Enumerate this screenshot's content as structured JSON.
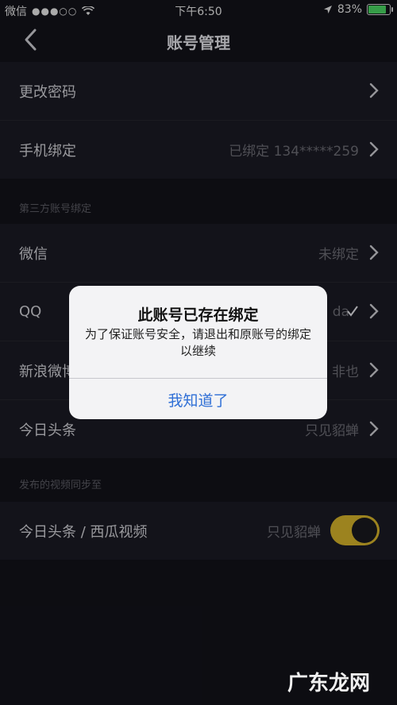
{
  "status": {
    "carrier": "微信",
    "signal_dots": "●●●○○",
    "time": "下午6:50",
    "battery_pct": "83%"
  },
  "nav": {
    "title": "账号管理"
  },
  "account": {
    "items": [
      {
        "label": "更改密码",
        "value": ""
      },
      {
        "label": "手机绑定",
        "value": "已绑定 134*****259"
      }
    ]
  },
  "third_party": {
    "header": "第三方账号绑定",
    "items": [
      {
        "label": "微信",
        "value": "未绑定"
      },
      {
        "label": "QQ",
        "value": "da"
      },
      {
        "label": "新浪微博",
        "value": "非也"
      },
      {
        "label": "今日头条",
        "value": "只见貂蝉"
      }
    ]
  },
  "sync": {
    "header": "发布的视频同步至",
    "item": {
      "label": "今日头条 / 西瓜视频",
      "value": "只见貂蝉",
      "enabled": true
    }
  },
  "alert": {
    "title": "此账号已存在绑定",
    "message": "为了保证账号安全，请退出和原账号的绑定以继续",
    "button": "我知道了"
  },
  "watermark": "广东龙网",
  "colors": {
    "background": "#12121a",
    "cell": "#1b1b24",
    "toggle": "#d8b62b",
    "alert_button": "#2f6fd6"
  }
}
